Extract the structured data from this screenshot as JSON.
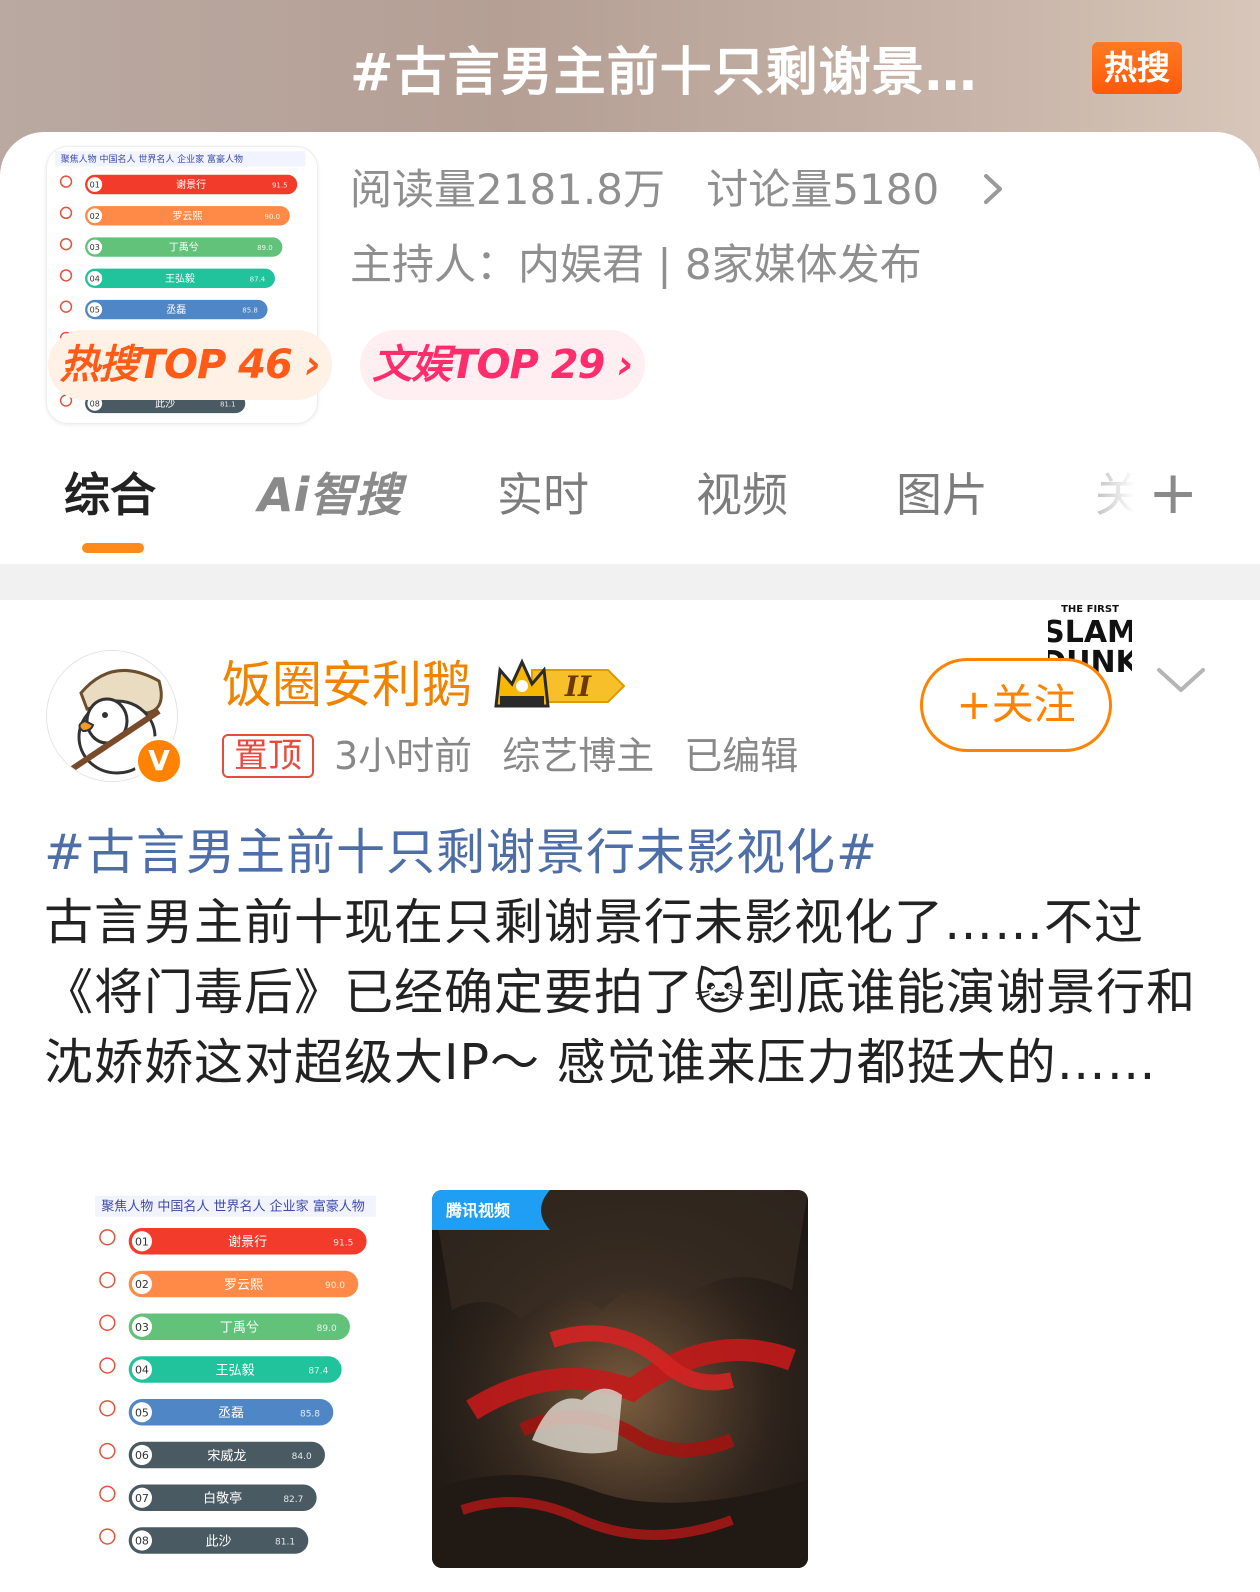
{
  "topic": {
    "title": "#古言男主前十只剩谢景…",
    "hot_badge": "热搜",
    "reads": "阅读量2181.8万",
    "discussions": "讨论量5180",
    "host": "主持人：内娱君 | 8家媒体发布"
  },
  "rank_pills": [
    {
      "label": "热搜TOP 46 ›"
    },
    {
      "label": "文娱TOP 29 ›"
    }
  ],
  "tabs": [
    {
      "label": "综合"
    },
    {
      "label": "Ai智搜"
    },
    {
      "label": "实时"
    },
    {
      "label": "视频"
    },
    {
      "label": "图片"
    },
    {
      "label": "关"
    },
    {
      "label": "+"
    }
  ],
  "ranking_card": {
    "header": "聚焦人物  中国名人  世界名人  企业家  富豪人物",
    "rows": [
      {
        "rank": "01",
        "name": "谢景行",
        "score": "91.5",
        "color": "#f23b2b"
      },
      {
        "rank": "02",
        "name": "罗云熙",
        "score": "90.0",
        "color": "#ff8a48"
      },
      {
        "rank": "03",
        "name": "丁禹兮",
        "score": "89.0",
        "color": "#62c27a"
      },
      {
        "rank": "04",
        "name": "王弘毅",
        "score": "87.4",
        "color": "#20c39b"
      },
      {
        "rank": "05",
        "name": "丞磊",
        "score": "85.8",
        "color": "#4f86c6"
      },
      {
        "rank": "06",
        "name": "宋威龙",
        "score": "84.0",
        "color": "#4a5a62"
      },
      {
        "rank": "07",
        "name": "白敬亭",
        "score": "82.7",
        "color": "#4a5a62"
      },
      {
        "rank": "08",
        "name": "此沙",
        "score": "81.1",
        "color": "#4a5a62"
      }
    ]
  },
  "post": {
    "username": "饭圈安利鹅",
    "level_badge": "II",
    "pin_tag": "置顶",
    "time": "3小时前",
    "category": "综艺博主",
    "edited": "已编辑",
    "follow_button": "+关注",
    "verified_badge": "V",
    "slam_dunk_text": "THE FIRST SLAM DUNK",
    "hashtag": "#古言男主前十只剩谢景行未影视化#",
    "body_part1": "古言男主前十现在只剩谢景行未影视化了……不过《将门毒后》已经确定要拍了",
    "emoji": "🐱",
    "body_part2": "到底谁能演谢景行和沈娇娇这对超级大IP～ 感觉谁来压力都挺大的……",
    "image2_logo": "腾讯视频"
  }
}
